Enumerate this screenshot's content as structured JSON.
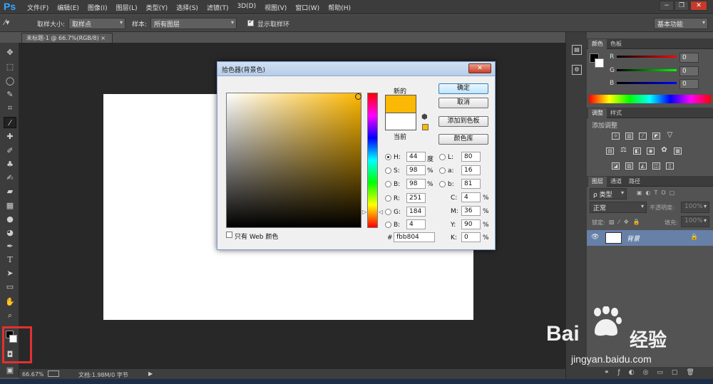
{
  "app": {
    "logo": "Ps"
  },
  "menu": [
    "文件(F)",
    "编辑(E)",
    "图像(I)",
    "图层(L)",
    "类型(Y)",
    "选择(S)",
    "滤镜(T)",
    "3D(D)",
    "视图(V)",
    "窗口(W)",
    "帮助(H)"
  ],
  "window_buttons": [
    "−",
    "❐",
    "✕"
  ],
  "options": {
    "sample_size_label": "取样大小:",
    "sample_size_value": "取样点",
    "sample_label": "样本:",
    "sample_value": "所有图层",
    "show_ring_label": "显示取样环",
    "workspace": "基本功能"
  },
  "document": {
    "tab_title": "未标题-1 @ 66.7%(RGB/8)"
  },
  "status": {
    "zoom": "66.67%",
    "doc_info": "文档:1.98M/0 字节"
  },
  "color_panel": {
    "tabs": [
      "颜色",
      "色板"
    ],
    "channels": [
      {
        "label": "R",
        "value": "0"
      },
      {
        "label": "G",
        "value": "0"
      },
      {
        "label": "B",
        "value": "0"
      }
    ]
  },
  "adjustments_panel": {
    "tabs": [
      "调整",
      "样式"
    ],
    "heading": "添加调整"
  },
  "layers_panel": {
    "tabs": [
      "图层",
      "通道",
      "路径"
    ],
    "filter_value": "ρ 类型",
    "blend_mode": "正常",
    "opacity_label": "不透明度:",
    "opacity_value": "100%",
    "lock_label": "锁定:",
    "fill_label": "填充:",
    "fill_value": "100%",
    "layers": [
      {
        "name": "背景"
      }
    ]
  },
  "dialog": {
    "title": "拾色器(背景色)",
    "close": "✕",
    "new_label": "新的",
    "current_label": "当前",
    "new_color": "#fbb804",
    "current_color": "#ffffff",
    "buttons": {
      "ok": "确定",
      "cancel": "取消",
      "add_swatch": "添加到色板",
      "libraries": "颜色库"
    },
    "fields": {
      "H": "44",
      "S": "98",
      "B": "98",
      "R": "251",
      "G": "184",
      "Bb": "4",
      "L": "80",
      "a": "16",
      "b": "81",
      "C": "4",
      "M": "36",
      "Y": "90",
      "K": "0"
    },
    "labels": {
      "H": "H:",
      "S": "S:",
      "B": "B:",
      "R": "R:",
      "G": "G:",
      "Bb": "B:",
      "L": "L:",
      "a": "a:",
      "b": "b:",
      "C": "C:",
      "M": "M:",
      "Y": "Y:",
      "K": "K:",
      "hex": "#"
    },
    "units": {
      "deg": "度",
      "pct": "%"
    },
    "hex": "fbb804",
    "web_only_label": "只有 Web 颜色",
    "hue_color": "#fbb804"
  },
  "watermark": {
    "brand_a": "Bai",
    "brand_b": "经验",
    "url": "jingyan.baidu.com"
  }
}
